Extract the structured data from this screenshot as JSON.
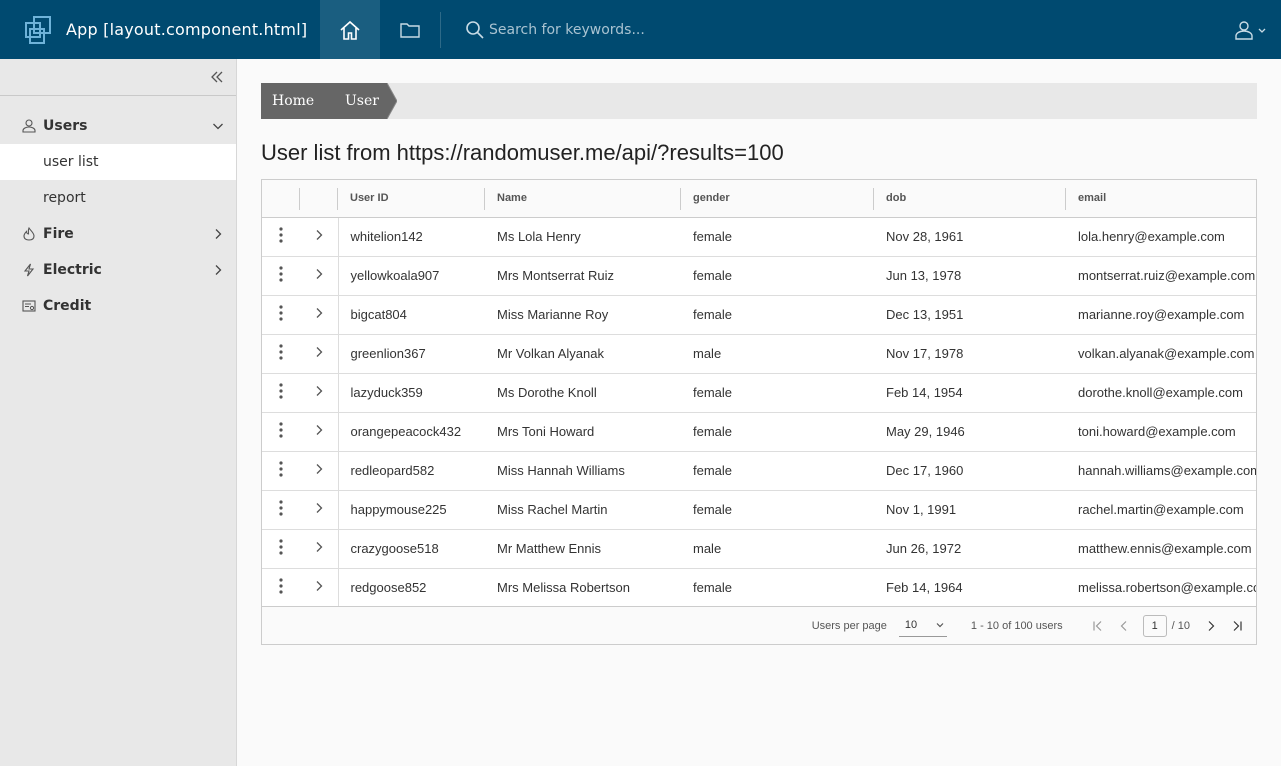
{
  "header": {
    "app_title": "App [layout.component.html]",
    "search_placeholder": "Search for keywords..."
  },
  "sidebar": {
    "groups": [
      {
        "label": "Users",
        "icon": "user-icon",
        "expanded": true,
        "items": [
          {
            "label": "user list",
            "active": true
          },
          {
            "label": "report",
            "active": false
          }
        ]
      },
      {
        "label": "Fire",
        "icon": "flame-icon",
        "expanded": false
      },
      {
        "label": "Electric",
        "icon": "bolt-icon",
        "expanded": false
      },
      {
        "label": "Credit",
        "icon": "credit-report-icon",
        "expanded": false
      }
    ]
  },
  "breadcrumb": [
    "Home",
    "User"
  ],
  "page_title": "User list from https://randomuser.me/api/?results=100",
  "table": {
    "columns": [
      "User ID",
      "Name",
      "gender",
      "dob",
      "email"
    ],
    "rows": [
      [
        "whitelion142",
        "Ms Lola Henry",
        "female",
        "Nov 28, 1961",
        "lola.henry@example.com"
      ],
      [
        "yellowkoala907",
        "Mrs Montserrat Ruiz",
        "female",
        "Jun 13, 1978",
        "montserrat.ruiz@example.com"
      ],
      [
        "bigcat804",
        "Miss Marianne Roy",
        "female",
        "Dec 13, 1951",
        "marianne.roy@example.com"
      ],
      [
        "greenlion367",
        "Mr Volkan Alyanak",
        "male",
        "Nov 17, 1978",
        "volkan.alyanak@example.com"
      ],
      [
        "lazyduck359",
        "Ms Dorothe Knoll",
        "female",
        "Feb 14, 1954",
        "dorothe.knoll@example.com"
      ],
      [
        "orangepeacock432",
        "Mrs Toni Howard",
        "female",
        "May 29, 1946",
        "toni.howard@example.com"
      ],
      [
        "redleopard582",
        "Miss Hannah Williams",
        "female",
        "Dec 17, 1960",
        "hannah.williams@example.com"
      ],
      [
        "happymouse225",
        "Miss Rachel Martin",
        "female",
        "Nov 1, 1991",
        "rachel.martin@example.com"
      ],
      [
        "crazygoose518",
        "Mr Matthew Ennis",
        "male",
        "Jun 26, 1972",
        "matthew.ennis@example.com"
      ],
      [
        "redgoose852",
        "Mrs Melissa Robertson",
        "female",
        "Feb 14, 1964",
        "melissa.robertson@example.com"
      ]
    ]
  },
  "pagination": {
    "per_page_label": "Users per page",
    "per_page_value": "10",
    "range_text": "1 - 10 of 100 users",
    "current_page": "1",
    "total_pages": "/ 10"
  },
  "colors": {
    "header_bg": "#004a70",
    "sidebar_bg": "#e8e8e8",
    "breadcrumb_bg": "#666666"
  }
}
